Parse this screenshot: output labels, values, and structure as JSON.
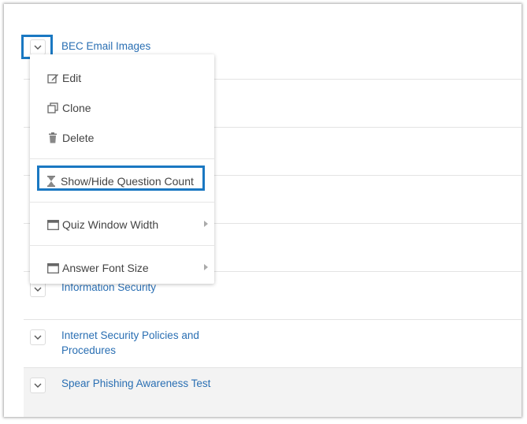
{
  "quiz_list": {
    "items": [
      {
        "title": "BEC Email Images"
      },
      {
        "title": "Information Security"
      },
      {
        "title": "Internet Security Policies and Procedures"
      },
      {
        "title": "Spear Phishing Awareness Test"
      }
    ],
    "chevron_glyph": "⌄"
  },
  "context_menu": {
    "edit_label": "Edit",
    "clone_label": "Clone",
    "delete_label": "Delete",
    "show_hide_label": "Show/Hide Question Count",
    "quiz_window_width_label": "Quiz Window Width",
    "answer_font_size_label": "Answer Font Size"
  },
  "colors": {
    "link": "#2a6fb3",
    "highlight": "#1a78c2"
  }
}
